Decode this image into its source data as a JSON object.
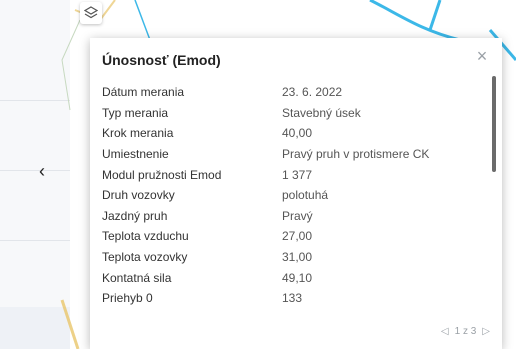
{
  "left_nav": {
    "back_icon": "chevron-left-icon",
    "back_glyph": "‹"
  },
  "map": {
    "layers_icon": "layers-icon",
    "road_color": "#3cb8e8"
  },
  "popup": {
    "title": "Únosnosť (Emod)",
    "close_glyph": "×",
    "rows": [
      {
        "label": "Dátum merania",
        "value": "23. 6. 2022"
      },
      {
        "label": "Typ merania",
        "value": "Stavebný úsek"
      },
      {
        "label": "Krok merania",
        "value": "40,00"
      },
      {
        "label": "Umiestnenie",
        "value": "Pravý pruh v protismere CK"
      },
      {
        "label": "Modul pružnosti Emod",
        "value": "1 377"
      },
      {
        "label": "Druh vozovky",
        "value": "polotuhá"
      },
      {
        "label": "Jazdný pruh",
        "value": "Pravý"
      },
      {
        "label": "Teplota vzduchu",
        "value": "27,00"
      },
      {
        "label": "Teplota vozovky",
        "value": "31,00"
      },
      {
        "label": "Kontatná sila",
        "value": "49,10"
      },
      {
        "label": "Priehyb 0",
        "value": "133"
      }
    ],
    "pager": {
      "prev_glyph": "◁",
      "text": "1 z 3",
      "next_glyph": "▷"
    }
  }
}
